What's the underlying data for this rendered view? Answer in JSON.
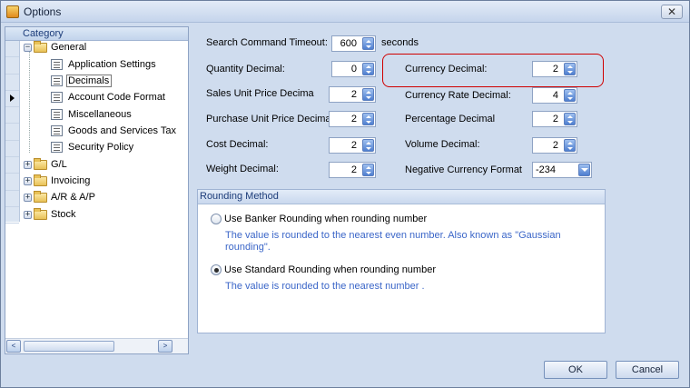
{
  "window": {
    "title": "Options",
    "close_glyph": "✕"
  },
  "sidebar": {
    "header": "Category",
    "tree": [
      {
        "label": "General",
        "expander": "−"
      },
      {
        "label": "Application Settings"
      },
      {
        "label": "Decimals"
      },
      {
        "label": "Account Code Format"
      },
      {
        "label": "Miscellaneous"
      },
      {
        "label": "Goods and Services Tax"
      },
      {
        "label": "Security Policy"
      },
      {
        "label": "G/L",
        "expander": "+"
      },
      {
        "label": "Invoicing",
        "expander": "+"
      },
      {
        "label": "A/R & A/P",
        "expander": "+"
      },
      {
        "label": "Stock",
        "expander": "+"
      }
    ],
    "selected": "Decimals",
    "scroll_left": "<",
    "scroll_right": ">"
  },
  "settings": {
    "search_timeout_label": "Search Command Timeout:",
    "search_timeout_value": "600",
    "search_timeout_unit": "seconds",
    "quantity_decimal_label": "Quantity Decimal:",
    "quantity_decimal_value": "0",
    "sales_unit_price_label": "Sales Unit Price Decima",
    "sales_unit_price_value": "2",
    "purchase_unit_price_label": "Purchase Unit Price Decima",
    "purchase_unit_price_value": "2",
    "cost_decimal_label": "Cost Decimal:",
    "cost_decimal_value": "2",
    "weight_decimal_label": "Weight Decimal:",
    "weight_decimal_value": "2",
    "currency_decimal_label": "Currency Decimal:",
    "currency_decimal_value": "2",
    "currency_rate_label": "Currency Rate Decimal:",
    "currency_rate_value": "4",
    "percentage_label": "Percentage Decimal",
    "percentage_value": "2",
    "volume_label": "Volume Decimal:",
    "volume_value": "2",
    "neg_currency_label": "Negative Currency Format",
    "neg_currency_value": "-234"
  },
  "rounding": {
    "title": "Rounding Method",
    "banker_label": "Use Banker Rounding when rounding number",
    "banker_desc_1": "The value is rounded to the nearest even number. Also known as \"Gaussian",
    "banker_desc_2": "rounding\".",
    "standard_label": "Use Standard Rounding when rounding number",
    "standard_desc": "The value is rounded to the nearest number .",
    "selected": "standard"
  },
  "buttons": {
    "ok": "OK",
    "cancel": "Cancel"
  },
  "colors": {
    "highlight": "#d00000",
    "desc_text": "#3b66c8",
    "accent": "#1d3d7a"
  }
}
